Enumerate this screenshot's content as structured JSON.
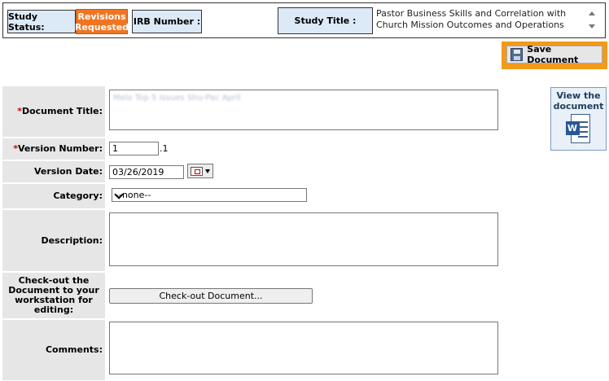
{
  "header": {
    "study_status_label": "Study Status:",
    "study_status_value": "Revisions Requested",
    "irb_number_label": "IRB Number :",
    "irb_number_value": "",
    "study_title_label": "Study Title :",
    "study_title_value": "Pastor Business Skills and Correlation with Church Mission Outcomes and Operations"
  },
  "toolbar": {
    "save_label": "Save Document",
    "save_icon": "floppy-disk-icon"
  },
  "view_document": {
    "label": "View the document",
    "icon": "word-document-icon"
  },
  "form": {
    "document_title": {
      "label": "Document Title:",
      "value": "Melo Top 5 Issues Shu-Pac April"
    },
    "version_number": {
      "label": "Version Number:",
      "value": "1",
      "suffix": ".1"
    },
    "version_date": {
      "label": "Version Date:",
      "value": "03/26/2019"
    },
    "category": {
      "label": "Category:",
      "value": "--none--"
    },
    "description": {
      "label": "Description:",
      "value": ""
    },
    "checkout": {
      "label": "Check-out the Document to your workstation for editing:",
      "button": "Check-out Document..."
    },
    "comments": {
      "label": "Comments:",
      "value": ""
    }
  },
  "colors": {
    "status_badge": "#f07522",
    "save_highlight": "#f29a19",
    "label_bg": "#e6e6e6",
    "header_label_bg": "#dce9f7",
    "required": "#cc0000"
  }
}
